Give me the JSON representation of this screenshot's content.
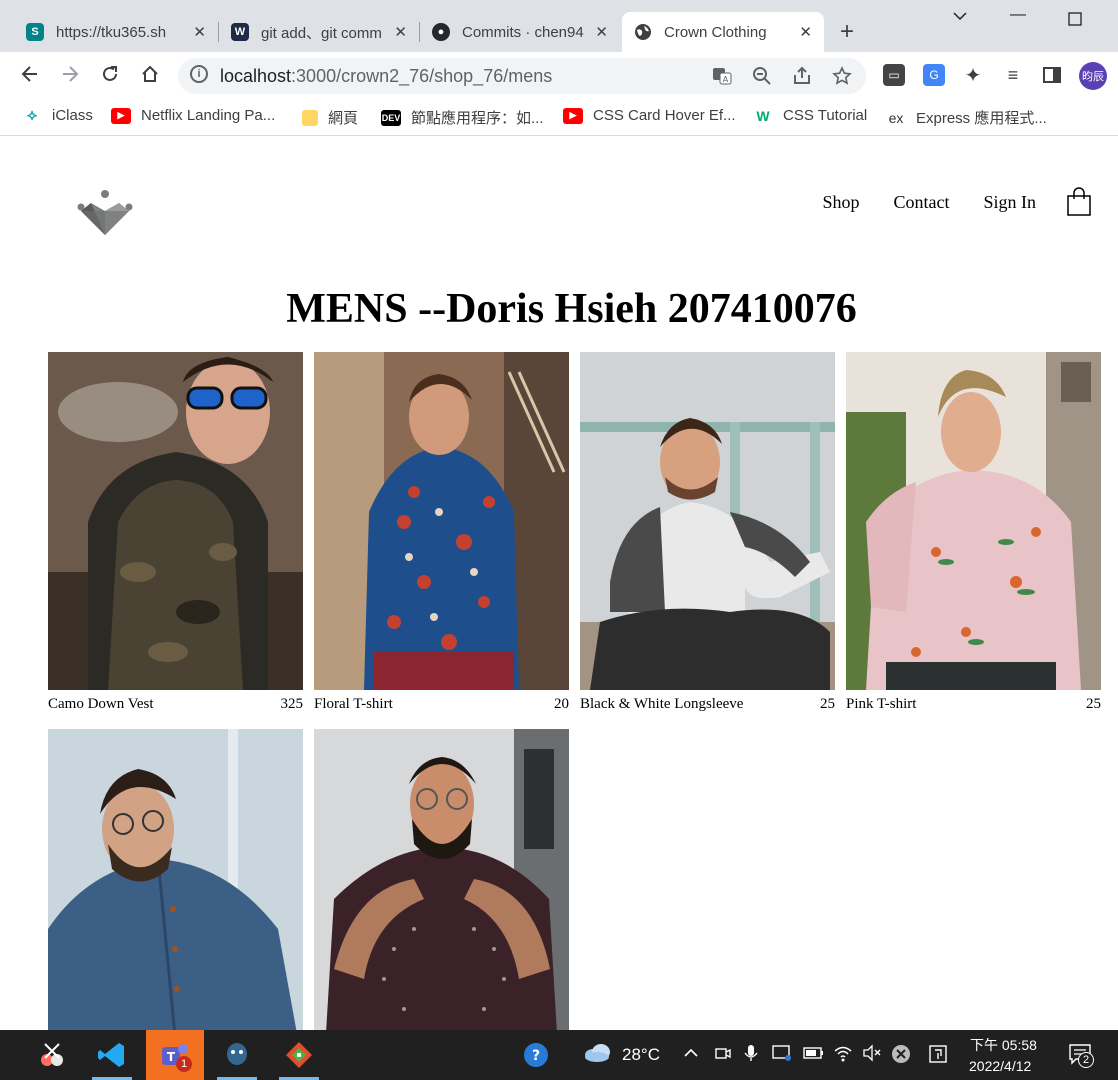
{
  "browser": {
    "tabs": [
      {
        "title": "https://tku365.sh",
        "favicon": "sharepoint-icon",
        "active": false
      },
      {
        "title": "git add、git comm",
        "favicon": "git-icon",
        "active": false
      },
      {
        "title": "Commits · chen94",
        "favicon": "github-icon",
        "active": false
      },
      {
        "title": "Crown Clothing",
        "favicon": "globe-icon",
        "active": true
      }
    ],
    "url_host": "localhost",
    "url_path": ":3000/crown2_76/shop_76/mens",
    "bookmarks": [
      {
        "label": "iClass",
        "icon": "iclass-icon"
      },
      {
        "label": "Netflix Landing Pa...",
        "icon": "youtube-icon"
      },
      {
        "label": "網頁",
        "icon": "folder-icon"
      },
      {
        "label": "節點應用程序：如...",
        "icon": "dev-icon"
      },
      {
        "label": "CSS Card Hover Ef...",
        "icon": "youtube-icon"
      },
      {
        "label": "CSS Tutorial",
        "icon": "w3schools-icon"
      },
      {
        "label": "Express 應用程式...",
        "icon": "express-icon"
      }
    ],
    "profile_initial": "昀辰",
    "dev_badge": "DEV",
    "express_badge": "ex"
  },
  "site": {
    "nav": {
      "shop": "Shop",
      "contact": "Contact",
      "sign_in": "Sign In"
    },
    "title": "MENS --Doris Hsieh 207410076",
    "items": [
      {
        "name": "Camo Down Vest",
        "price": "325"
      },
      {
        "name": "Floral T-shirt",
        "price": "20"
      },
      {
        "name": "Black & White Longsleeve",
        "price": "25"
      },
      {
        "name": "Pink T-shirt",
        "price": "25"
      },
      {
        "name": "",
        "price": ""
      },
      {
        "name": "",
        "price": ""
      }
    ]
  },
  "taskbar": {
    "temperature": "28°C",
    "time": "下午 05:58",
    "date": "2022/4/12",
    "teams_badge": "1",
    "notifications": "2"
  }
}
